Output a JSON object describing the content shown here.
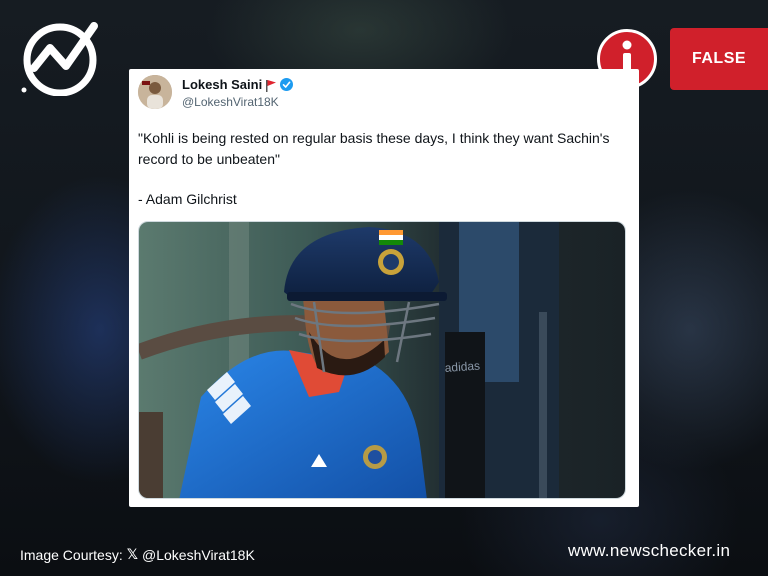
{
  "logo": {
    "name": "newschecker-logo-icon"
  },
  "verdict": {
    "icon": "info-icon",
    "label": "FALSE",
    "color": "#d0202b"
  },
  "tweet": {
    "author_name": "Lokesh Saini",
    "author_handle": "@LokeshVirat18K",
    "flag_icon": "red-flag-icon",
    "verified_icon": "verified-badge-icon",
    "text": "\"Kohli is being rested on regular basis these days, I think they want Sachin's record to be unbeaten\"",
    "attribution": "- Adam Gilchrist",
    "media": {
      "icon": "cricketer-photo",
      "visible_text": [
        "adidas"
      ]
    }
  },
  "footer": {
    "credit_prefix": "Image Courtesy:",
    "credit_icon": "x-logo-icon",
    "credit_handle": "@LokeshVirat18K",
    "site": "www.newschecker.in"
  },
  "colors": {
    "background": "#0f1419",
    "card": "#ffffff",
    "jersey": "#1f6fd0"
  }
}
